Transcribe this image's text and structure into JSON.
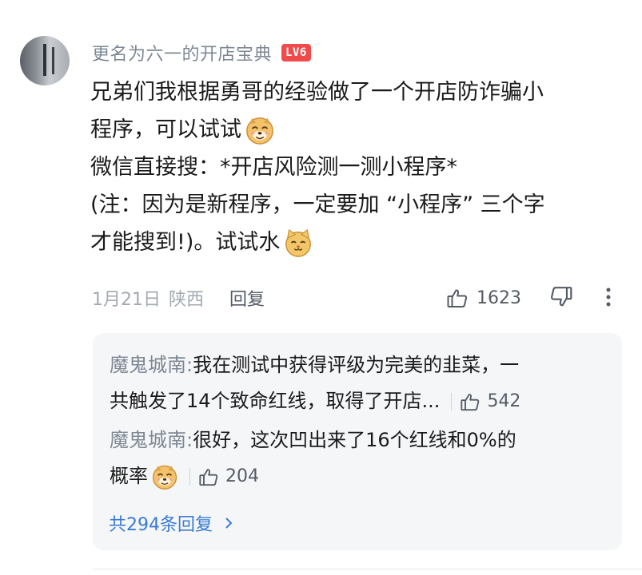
{
  "comment": {
    "username": "更名为六一的开店宝典",
    "level_badge": "LV6",
    "lines": [
      "兄弟们我根据勇哥的经验做了一个开店防诈骗小",
      "程序，可以试试",
      "微信直接搜：*开店风险测一测小程序*",
      "(注：因为是新程序，一定要加 “小程序” 三个字",
      "才能搜到!)。试试水"
    ],
    "emojis": [
      "doge-smile-icon",
      "cat-smile-icon"
    ],
    "date": "1月21日",
    "location": "陕西",
    "reply_label": "回复",
    "like_count": "1623"
  },
  "replies": [
    {
      "name": "魔鬼城南:",
      "line1": " 我在测试中获得评级为完美的韭菜，一",
      "line2": "共触发了14个致命红线，取得了开店...",
      "like_count": "542"
    },
    {
      "name": "魔鬼城南:",
      "line1": " 很好，这次凹出来了16个红线和0%的",
      "line2": "概率",
      "like_count": "204"
    }
  ],
  "more_replies_label": "共294条回复",
  "colors": {
    "accent_link": "#3a7bd5",
    "level_badge": "#f04a4a",
    "username": "#7e8894",
    "reply_box_bg": "#f5f6f8"
  }
}
